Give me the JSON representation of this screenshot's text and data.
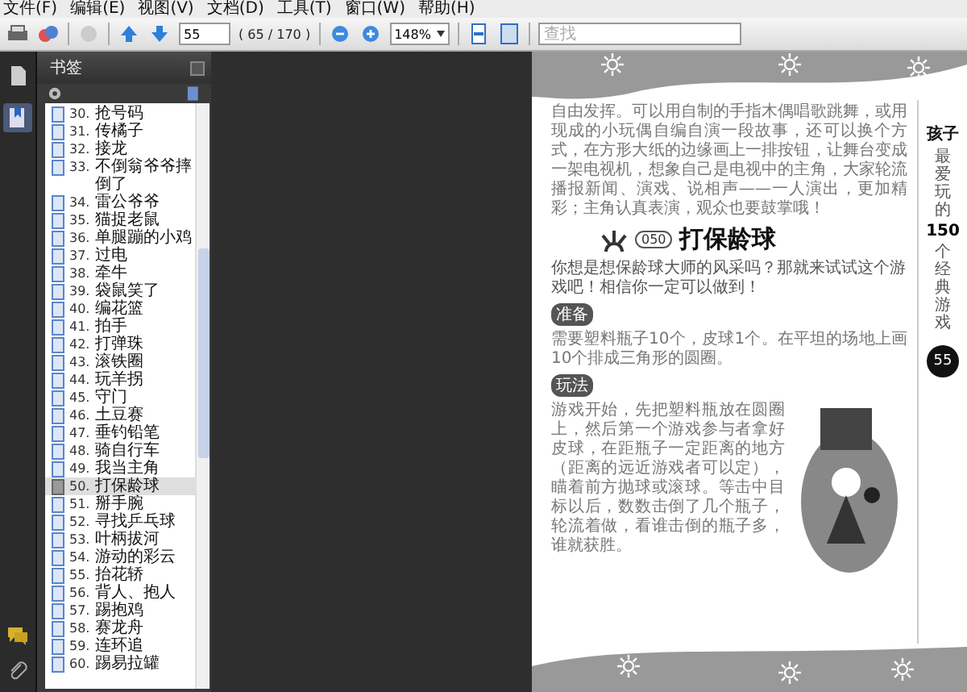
{
  "menu": [
    "文件(F)",
    "编辑(E)",
    "视图(V)",
    "文档(D)",
    "工具(T)",
    "窗口(W)",
    "帮助(H)"
  ],
  "toolbar": {
    "page_number": "55",
    "page_count": "( 65 / 170 )",
    "zoom": "148%",
    "search": {
      "placeholder": "查找"
    }
  },
  "sidebar_tabs": [
    {
      "kind": "pages",
      "selected": false
    },
    {
      "kind": "bookmarks",
      "selected": true
    }
  ],
  "bookmarks": {
    "title": "书签",
    "items": [
      {
        "number": "30.",
        "label": "抢号码",
        "selected": false
      },
      {
        "number": "31.",
        "label": "传橘子",
        "selected": false
      },
      {
        "number": "32.",
        "label": "接龙",
        "selected": false
      },
      {
        "number": "33.",
        "label": "不倒翁爷爷摔倒了",
        "selected": false
      },
      {
        "number": "34.",
        "label": "雷公爷爷",
        "selected": false
      },
      {
        "number": "35.",
        "label": "猫捉老鼠",
        "selected": false
      },
      {
        "number": "36.",
        "label": "单腿蹦的小鸡",
        "selected": false
      },
      {
        "number": "37.",
        "label": "过电",
        "selected": false
      },
      {
        "number": "38.",
        "label": "牵牛",
        "selected": false
      },
      {
        "number": "39.",
        "label": "袋鼠笑了",
        "selected": false
      },
      {
        "number": "40.",
        "label": "编花篮",
        "selected": false
      },
      {
        "number": "41.",
        "label": "拍手",
        "selected": false
      },
      {
        "number": "42.",
        "label": "打弹珠",
        "selected": false
      },
      {
        "number": "43.",
        "label": "滚铁圈",
        "selected": false
      },
      {
        "number": "44.",
        "label": "玩羊拐",
        "selected": false
      },
      {
        "number": "45.",
        "label": "守门",
        "selected": false
      },
      {
        "number": "46.",
        "label": "土豆赛",
        "selected": false
      },
      {
        "number": "47.",
        "label": "垂钓铅笔",
        "selected": false
      },
      {
        "number": "48.",
        "label": "骑自行车",
        "selected": false
      },
      {
        "number": "49.",
        "label": "我当主角",
        "selected": false
      },
      {
        "number": "50.",
        "label": "打保龄球",
        "selected": true
      },
      {
        "number": "51.",
        "label": "掰手腕",
        "selected": false
      },
      {
        "number": "52.",
        "label": "寻找乒乓球",
        "selected": false
      },
      {
        "number": "53.",
        "label": "叶柄拔河",
        "selected": false
      },
      {
        "number": "54.",
        "label": "游动的彩云",
        "selected": false
      },
      {
        "number": "55.",
        "label": "抬花轿",
        "selected": false
      },
      {
        "number": "56.",
        "label": "背人、抱人",
        "selected": false
      },
      {
        "number": "57.",
        "label": "踢抱鸡",
        "selected": false
      },
      {
        "number": "58.",
        "label": "赛龙舟",
        "selected": false
      },
      {
        "number": "59.",
        "label": "连环追",
        "selected": false
      },
      {
        "number": "60.",
        "label": "踢易拉罐",
        "selected": false
      }
    ]
  },
  "document": {
    "intro_paragraph": "自由发挥。可以用自制的手指木偶唱歌跳舞，或用现成的小玩偶自编自演一段故事，还可以换个方式，在方形大纸的边缘画上一排按钮，让舞台变成一架电视机，想象自己是电视中的主角，大家轮流播报新闻、演戏、说相声——一人演出，更加精彩；主角认真表演，观众也要鼓掌哦！",
    "game_number": "050",
    "game_title": "打保龄球",
    "lead": "你想是想保龄球大师的风采吗？那就来试试这个游戏吧！相信你一定可以做到！",
    "sections": [
      {
        "heading": "准备",
        "text": "需要塑料瓶子10个，皮球1个。在平坦的场地上画10个排成三角形的圆圈。"
      },
      {
        "heading": "玩法",
        "text": "游戏开始，先把塑料瓶放在圆圈上，然后第一个游戏参与者拿好皮球，在距瓶子一定距离的地方（距离的远近游戏者可以定），瞄着前方抛球或滚球。等击中目标以后，数数击倒了几个瓶子，轮流着做，看谁击倒的瓶子多，谁就获胜。"
      }
    ],
    "side_title": "孩子",
    "side_line1": "最爱玩的",
    "side_number": "150",
    "side_line2": "个经典游戏",
    "page_number": "55"
  }
}
